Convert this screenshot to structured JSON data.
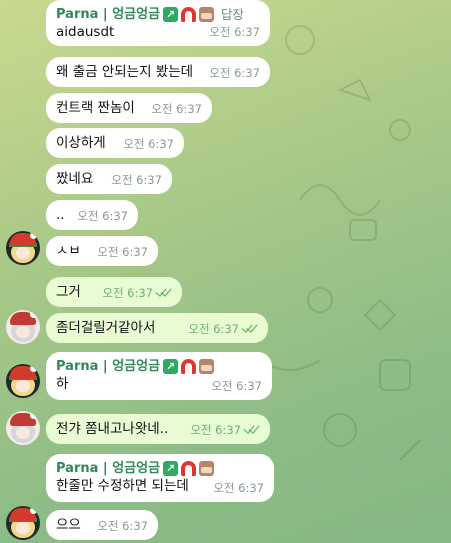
{
  "chat": {
    "reply_label": "답장",
    "messages": [
      {
        "id": "m1",
        "dir": "in",
        "sender": "Parna | 엉금엉금",
        "text": "aidausdt",
        "time": "오전 6:37",
        "has_reply": true
      },
      {
        "id": "m2",
        "dir": "in",
        "text": "왜 출금 안되는지 봤는데",
        "time": "오전 6:37"
      },
      {
        "id": "m3",
        "dir": "in",
        "text": "컨트랙 짠놈이",
        "time": "오전 6:37"
      },
      {
        "id": "m4",
        "dir": "in",
        "text": "이상하게",
        "time": "오전 6:37"
      },
      {
        "id": "m5",
        "dir": "in",
        "text": "짰네요",
        "time": "오전 6:37"
      },
      {
        "id": "m6",
        "dir": "in",
        "text": "..",
        "time": "오전 6:37"
      },
      {
        "id": "m7",
        "dir": "in",
        "text": "ㅅㅂ",
        "time": "오전 6:37"
      },
      {
        "id": "m8",
        "dir": "out",
        "text": "그거",
        "time": "오전 6:37",
        "read": true
      },
      {
        "id": "m9",
        "dir": "out",
        "text": "좀더걸릴거같아서",
        "time": "오전 6:37",
        "read": true
      },
      {
        "id": "m10",
        "dir": "in",
        "sender": "Parna | 엉금엉금",
        "text": "하",
        "time": "오전 6:37"
      },
      {
        "id": "m11",
        "dir": "out",
        "text": "전갸 쫌내고나왓네..",
        "time": "오전 6:37",
        "read": true
      },
      {
        "id": "m12",
        "dir": "in",
        "sender": "Parna | 엉금엉금",
        "text": "한줄만 수정하면 되는데",
        "time": "오전 6:37"
      },
      {
        "id": "m13",
        "dir": "in",
        "text": "으으",
        "time": "오전 6:37"
      }
    ]
  },
  "icons": {
    "sender_badges": [
      "chart-up-emoji",
      "magnet-emoji",
      "face-emoji"
    ],
    "read_receipt": "double-check-icon"
  },
  "colors": {
    "sender_name": "#2f8a57",
    "incoming_bubble": "#ffffff",
    "outgoing_bubble": "#e8fbd3",
    "read_check": "#4fae4e"
  }
}
